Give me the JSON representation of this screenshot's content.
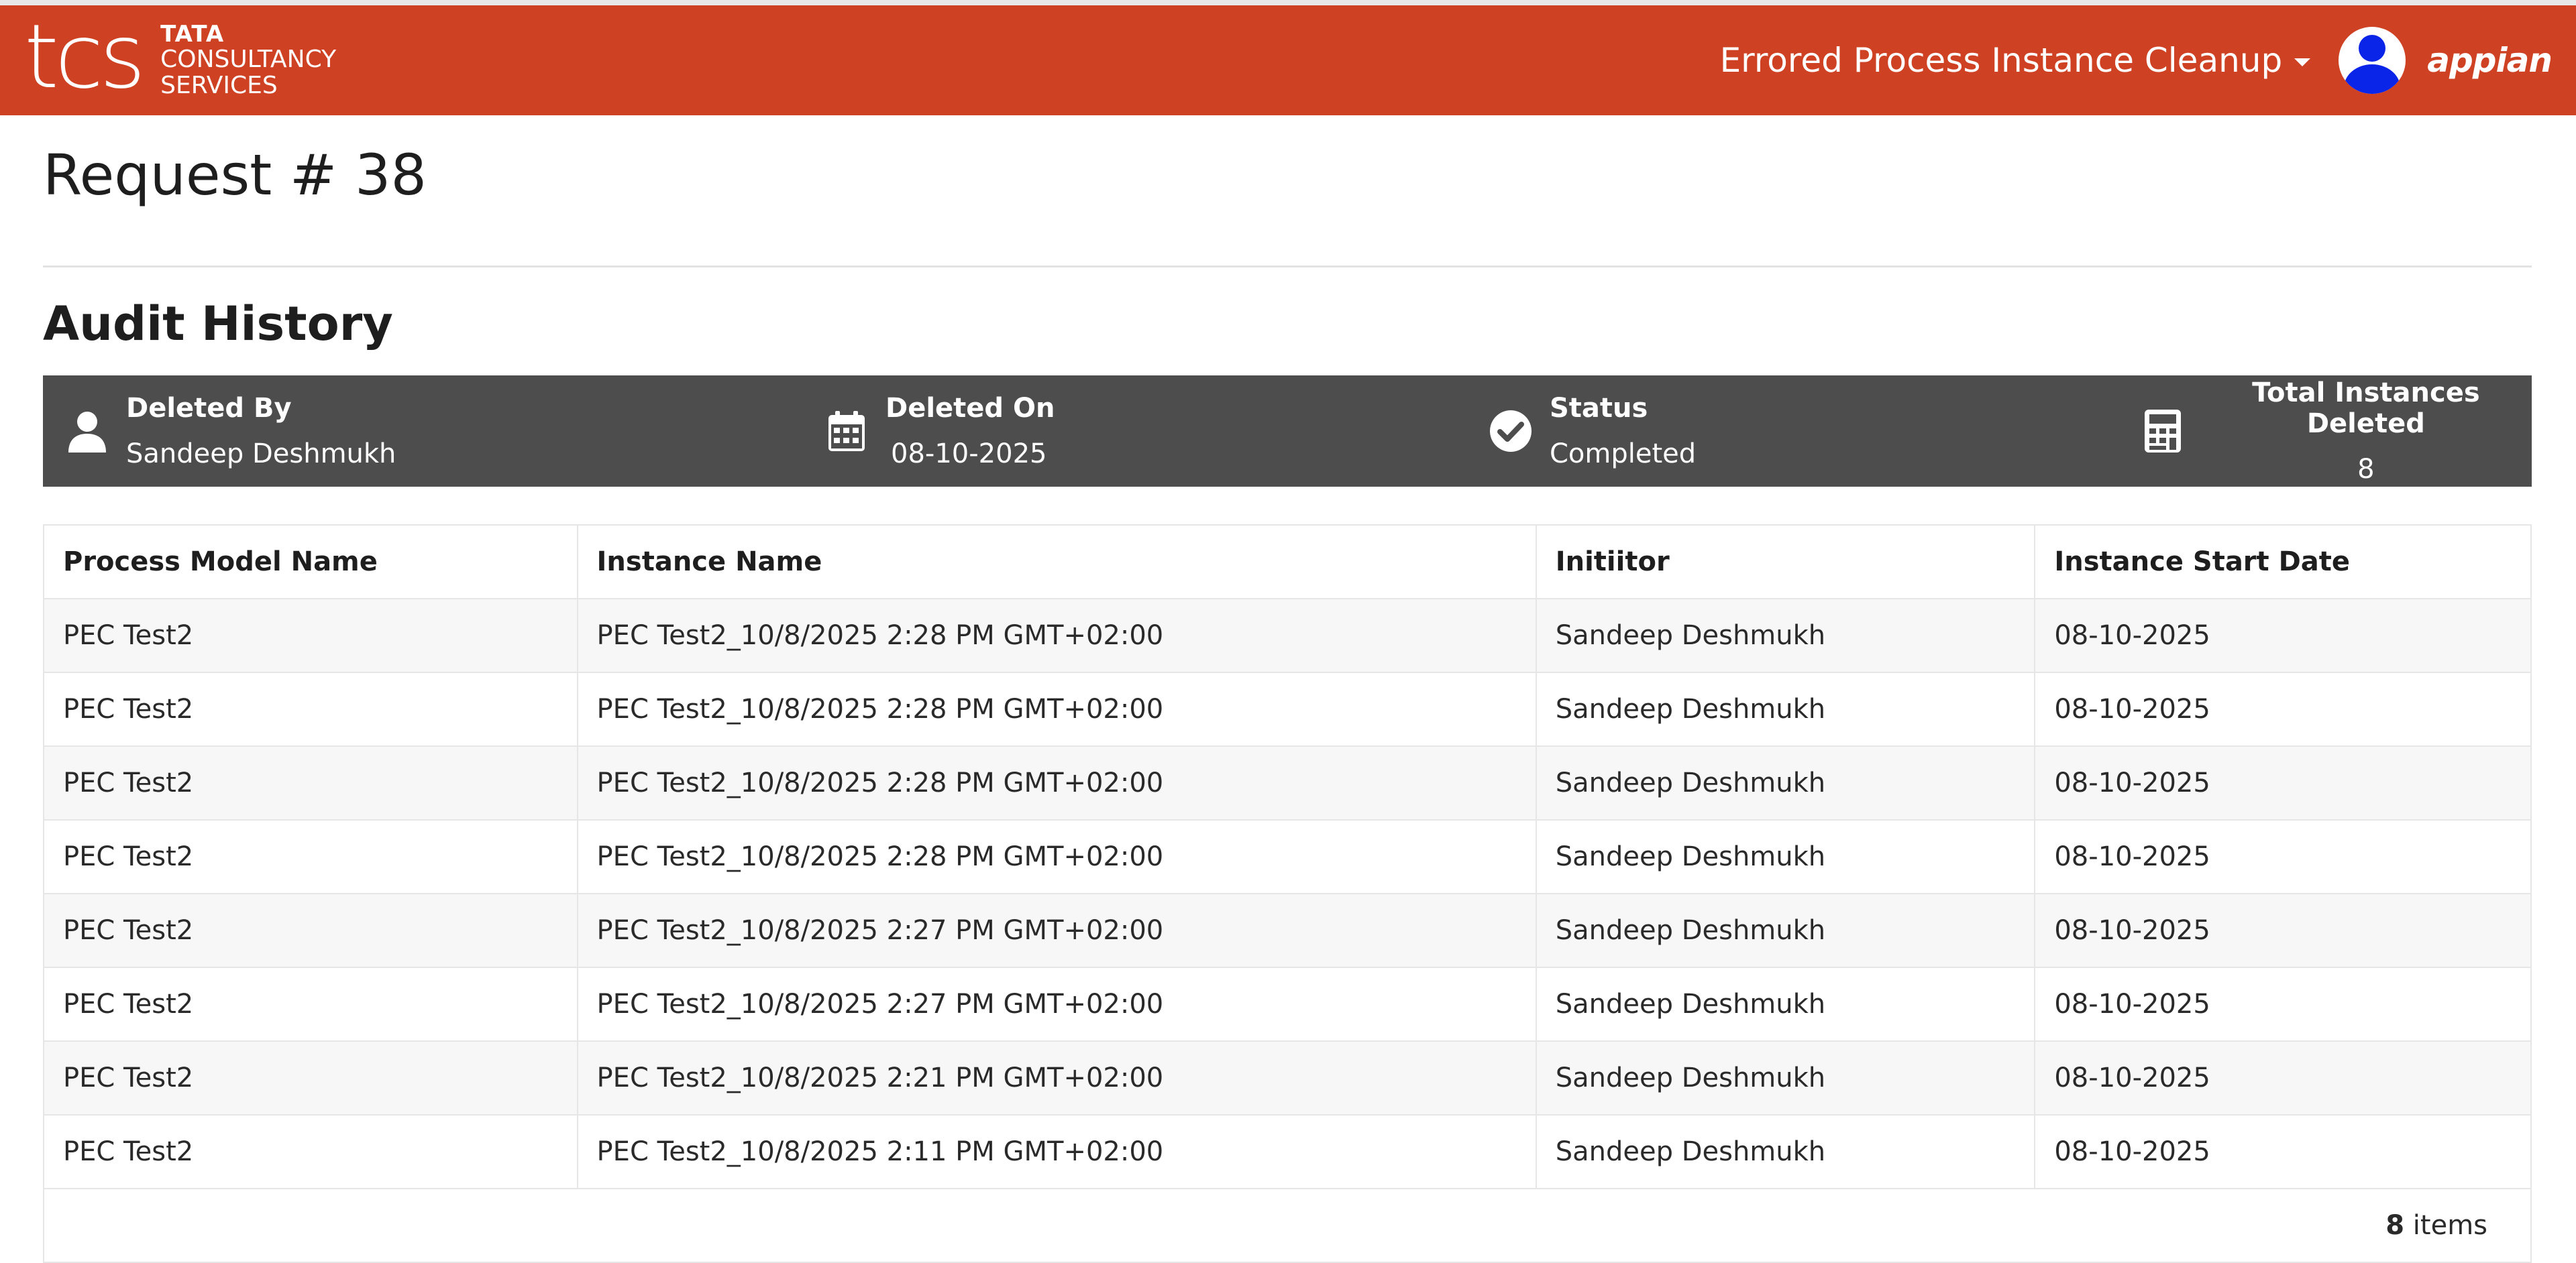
{
  "header": {
    "brand_mark": "tcs",
    "brand_line1": "TATA",
    "brand_line2": "CONSULTANCY",
    "brand_line3": "SERVICES",
    "app_name": "Errored Process Instance Cleanup",
    "appian_logo": "appian",
    "accent_color": "#cf4123"
  },
  "page": {
    "title": "Request # 38",
    "section_title": "Audit History"
  },
  "summary": {
    "deleted_by": {
      "label": "Deleted By",
      "value": "Sandeep Deshmukh",
      "icon": "user-icon"
    },
    "deleted_on": {
      "label": "Deleted On",
      "value": "08-10-2025",
      "icon": "calendar-icon"
    },
    "status": {
      "label": "Status",
      "value": "Completed",
      "icon": "check-circle-icon"
    },
    "total": {
      "label": "Total Instances Deleted",
      "value": "8",
      "icon": "calculator-icon"
    }
  },
  "table": {
    "columns": [
      "Process Model Name",
      "Instance Name",
      "Initiitor",
      "Instance Start Date"
    ],
    "rows": [
      [
        "PEC Test2",
        "PEC Test2_10/8/2025 2:28 PM GMT+02:00",
        "Sandeep Deshmukh",
        "08-10-2025"
      ],
      [
        "PEC Test2",
        "PEC Test2_10/8/2025 2:28 PM GMT+02:00",
        "Sandeep Deshmukh",
        "08-10-2025"
      ],
      [
        "PEC Test2",
        "PEC Test2_10/8/2025 2:28 PM GMT+02:00",
        "Sandeep Deshmukh",
        "08-10-2025"
      ],
      [
        "PEC Test2",
        "PEC Test2_10/8/2025 2:28 PM GMT+02:00",
        "Sandeep Deshmukh",
        "08-10-2025"
      ],
      [
        "PEC Test2",
        "PEC Test2_10/8/2025 2:27 PM GMT+02:00",
        "Sandeep Deshmukh",
        "08-10-2025"
      ],
      [
        "PEC Test2",
        "PEC Test2_10/8/2025 2:27 PM GMT+02:00",
        "Sandeep Deshmukh",
        "08-10-2025"
      ],
      [
        "PEC Test2",
        "PEC Test2_10/8/2025 2:21 PM GMT+02:00",
        "Sandeep Deshmukh",
        "08-10-2025"
      ],
      [
        "PEC Test2",
        "PEC Test2_10/8/2025 2:11 PM GMT+02:00",
        "Sandeep Deshmukh",
        "08-10-2025"
      ]
    ],
    "footer_count": "8",
    "footer_label": "items"
  }
}
